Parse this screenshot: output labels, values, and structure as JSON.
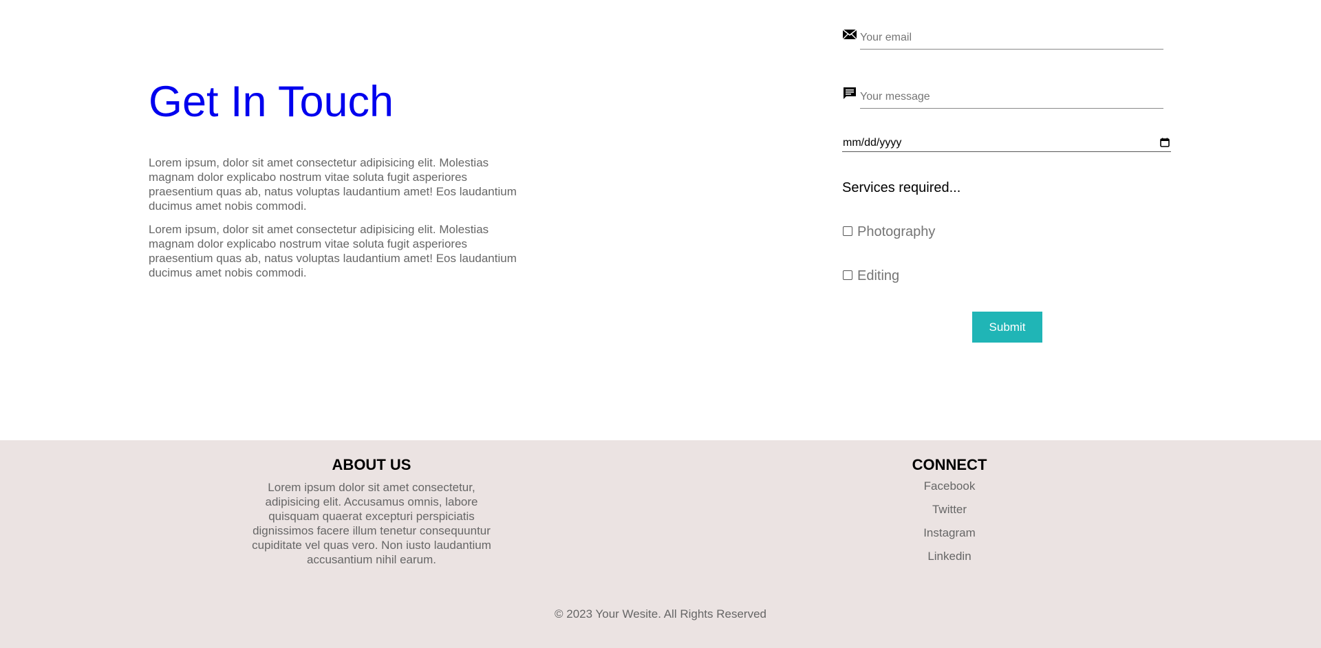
{
  "intro": {
    "title": "Get In Touch",
    "paragraphs": [
      "Lorem ipsum, dolor sit amet consectetur adipisicing elit. Molestias magnam dolor explicabo nostrum vitae soluta fugit asperiores praesentium quas ab, natus voluptas laudantium amet! Eos laudantium ducimus amet nobis commodi.",
      "Lorem ipsum, dolor sit amet consectetur adipisicing elit. Molestias magnam dolor explicabo nostrum vitae soluta fugit asperiores praesentium quas ab, natus voluptas laudantium amet! Eos laudantium ducimus amet nobis commodi."
    ]
  },
  "form": {
    "email": {
      "placeholder": "Your email",
      "value": "",
      "icon": "envelope-icon"
    },
    "message": {
      "placeholder": "Your message",
      "value": "",
      "icon": "chat-icon"
    },
    "date": {
      "text": "mm/dd/yyyy",
      "icon": "calendar-icon"
    },
    "services_label": "Services required...",
    "options": [
      {
        "label": "Photography",
        "checked": false
      },
      {
        "label": "Editing",
        "checked": false
      }
    ],
    "submit_label": "Submit",
    "submit_color": "#20b5b6"
  },
  "footer": {
    "about": {
      "heading": "ABOUT US",
      "text": "Lorem ipsum dolor sit amet consectetur, adipisicing elit. Accusamus omnis, labore quisquam quaerat excepturi perspiciatis dignissimos facere illum tenetur consequuntur cupiditate vel quas vero. Non iusto laudantium accusantium nihil earum."
    },
    "connect": {
      "heading": "CONNECT",
      "links": [
        "Facebook",
        "Twitter",
        "Instagram",
        "Linkedin"
      ]
    },
    "copyright": "© 2023 Your Wesite. All Rights Reserved",
    "background": "#ebe3e2"
  },
  "colors": {
    "title": "#0000ee",
    "body_text": "#666666"
  }
}
